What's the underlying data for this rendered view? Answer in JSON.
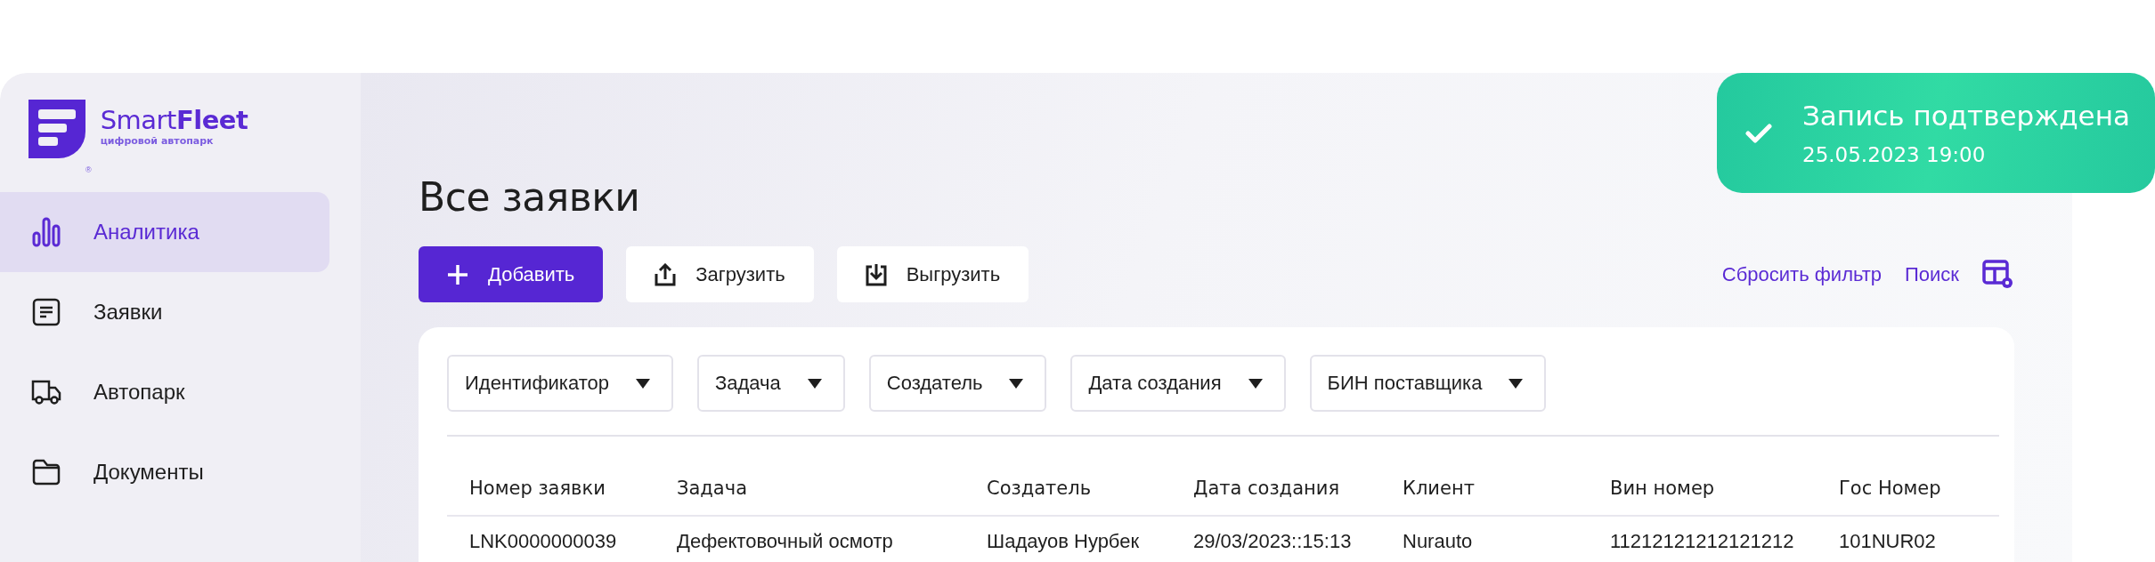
{
  "toast": {
    "title": "Запись подтверждена",
    "time": "25.05.2023 19:00"
  },
  "logo": {
    "name": "Smart**Fleet**",
    "tagline": "цифровой автопарк",
    "mark": "®"
  },
  "sidebar": {
    "items": [
      {
        "label": "Аналитика",
        "kind": "analytics",
        "selected": true
      },
      {
        "label": "Заявки",
        "kind": "requests",
        "selected": false
      },
      {
        "label": "Автопарк",
        "kind": "fleet",
        "selected": false
      },
      {
        "label": "Документы",
        "kind": "documents",
        "selected": false
      }
    ]
  },
  "page": {
    "title": "Все заявки",
    "actions": [
      {
        "label": "Добавить",
        "kind": "add"
      },
      {
        "label": "Загрузить",
        "kind": "upload"
      },
      {
        "label": "Выгрузить",
        "kind": "download"
      }
    ],
    "links": [
      "Сбросить фильтр",
      "Поиск"
    ]
  },
  "filters": [
    "Идентификатор",
    "Задача",
    "Создатель",
    "Дата создания",
    "БИН поставщика"
  ],
  "table": {
    "columns": [
      "Номер заявки",
      "Задача",
      "Создатель",
      "Дата создания",
      "Клиент",
      "Вин номер",
      "Гос Номер"
    ],
    "rows": [
      [
        "LNK0000000039",
        "Дефектовочный осмотр",
        "Шадауов Нурбек",
        "29/03/2023::15:13",
        "Nurauto",
        "11212121212121212",
        "101NUR02"
      ]
    ]
  }
}
